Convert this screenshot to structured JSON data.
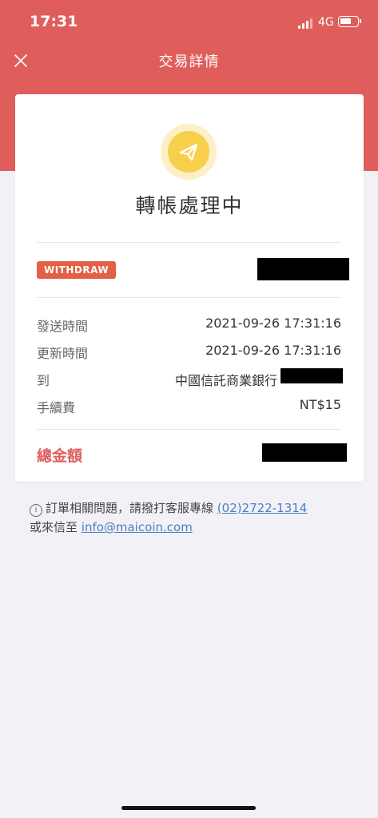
{
  "status_bar": {
    "time": "17:31",
    "network": "4G"
  },
  "nav": {
    "title": "交易詳情",
    "close_icon": "close-icon"
  },
  "transaction": {
    "status_icon": "paper-plane-icon",
    "status_text": "轉帳處理中",
    "type_badge": "WITHDRAW",
    "rows": [
      {
        "label": "發送時間",
        "value": "2021-09-26 17:31:16"
      },
      {
        "label": "更新時間",
        "value": "2021-09-26 17:31:16"
      },
      {
        "label": "到",
        "value": "中國信託商業銀行"
      },
      {
        "label": "手續費",
        "value": "NT$15"
      }
    ],
    "total_label": "總金額"
  },
  "help": {
    "text_before": "訂單相關問題，請撥打客服專線",
    "phone": "(02)2722-1314",
    "text_mid": "或來信至",
    "email": "info@maicoin.com"
  },
  "colors": {
    "header": "#df5e5c",
    "badge": "#e35f45",
    "icon_circle": "#f7cf4a",
    "link": "#4a7fc4"
  }
}
